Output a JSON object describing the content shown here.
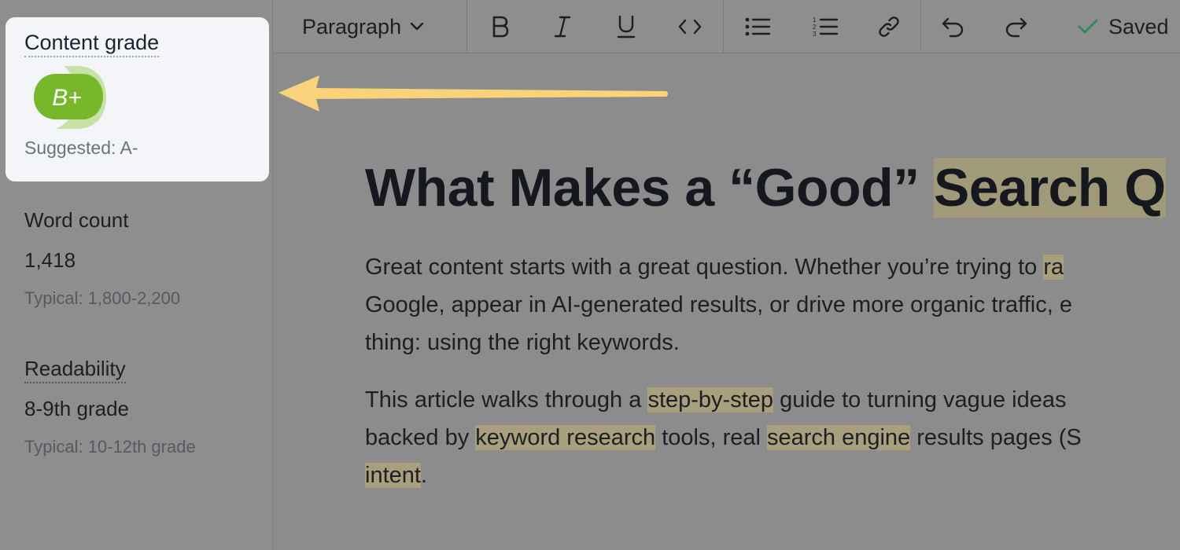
{
  "sidebar": {
    "content_grade": {
      "title": "Content grade",
      "grade": "B+",
      "suggested": "Suggested: A-"
    },
    "word_count": {
      "label": "Word count",
      "value": "1,418",
      "typical": "Typical: 1,800-2,200"
    },
    "readability": {
      "label": "Readability",
      "value": "8-9th grade",
      "typical": "Typical: 10-12th grade"
    }
  },
  "toolbar": {
    "paragraph_label": "Paragraph",
    "saved_label": "Saved",
    "icons": [
      "bold-icon",
      "italic-icon",
      "underline-icon",
      "code-icon",
      "bullet-list-icon",
      "numbered-list-icon",
      "link-icon",
      "undo-icon",
      "redo-icon",
      "check-icon"
    ]
  },
  "editor": {
    "title_plain": "What Makes a “Good” ",
    "title_highlight": "Search Q",
    "p1": {
      "l1_a": "Great content starts with a great question. Whether you’re trying to ",
      "l1_hl": "ra",
      "l2": "Google, appear in AI-generated results, or drive more organic traffic, e",
      "l3": "thing: using the right keywords."
    },
    "p2": {
      "l1_a": "This article walks through a ",
      "l1_hl": "step-by-step",
      "l1_b": " guide to turning vague ideas",
      "l2_a": "backed by ",
      "l2_hl1": "keyword research",
      "l2_b": " tools, real ",
      "l2_hl2": "search engine",
      "l2_c": " results pages (S",
      "l3_hl": "intent",
      "l3_b": "."
    }
  },
  "colors": {
    "grade_green": "#76b82a",
    "grade_ring": "#c8e2a6",
    "arrow": "#f9d27a",
    "check_green": "#2e8b57",
    "highlight": "#a89f7c"
  }
}
